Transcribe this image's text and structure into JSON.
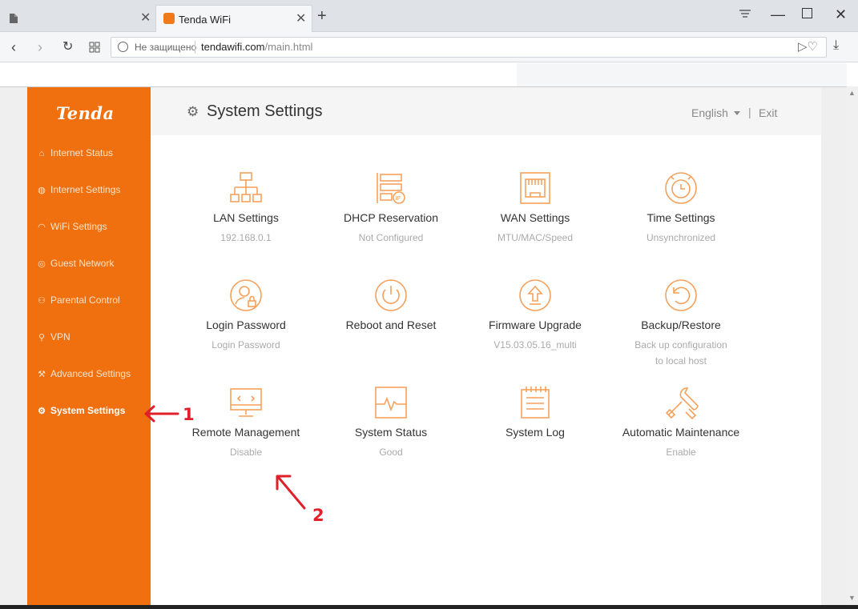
{
  "browser": {
    "tab_title": "Tenda WiFi",
    "security_label": "Не защищено",
    "url_host": "tendawifi.com",
    "url_path": "/main.html"
  },
  "app": {
    "logo": "Tenda",
    "page_title": "System Settings",
    "language": "English",
    "separator": "|",
    "exit": "Exit",
    "accent_color": "#f07010",
    "icon_color": "#f5a15c"
  },
  "sidebar": {
    "items": [
      {
        "label": "Internet Status",
        "icon": "router-icon"
      },
      {
        "label": "Internet Settings",
        "icon": "globe-icon"
      },
      {
        "label": "WiFi Settings",
        "icon": "wifi-icon"
      },
      {
        "label": "Guest Network",
        "icon": "guest-icon"
      },
      {
        "label": "Parental Control",
        "icon": "parental-icon"
      },
      {
        "label": "VPN",
        "icon": "vpn-icon"
      },
      {
        "label": "Advanced Settings",
        "icon": "wrench-icon"
      },
      {
        "label": "System Settings",
        "icon": "gear-icon",
        "active": true
      }
    ]
  },
  "tiles": [
    {
      "label": "LAN Settings",
      "sub": "192.168.0.1",
      "icon": "lan-icon"
    },
    {
      "label": "DHCP Reservation",
      "sub": "Not Configured",
      "icon": "dhcp-icon"
    },
    {
      "label": "WAN Settings",
      "sub": "MTU/MAC/Speed",
      "icon": "wan-icon"
    },
    {
      "label": "Time Settings",
      "sub": "Unsynchronized",
      "icon": "clock-icon"
    },
    {
      "label": "Login Password",
      "sub": "Login Password",
      "icon": "user-lock-icon"
    },
    {
      "label": "Reboot and Reset",
      "sub": "",
      "icon": "power-icon"
    },
    {
      "label": "Firmware Upgrade",
      "sub": "V15.03.05.16_multi",
      "icon": "upgrade-icon"
    },
    {
      "label": "Backup/Restore",
      "sub": "Back up configuration to local host",
      "icon": "backup-icon"
    },
    {
      "label": "Remote Management",
      "sub": "Disable",
      "icon": "monitor-icon"
    },
    {
      "label": "System Status",
      "sub": "Good",
      "icon": "status-icon"
    },
    {
      "label": "System Log",
      "sub": "",
      "icon": "log-icon"
    },
    {
      "label": "Automatic Maintenance",
      "sub": "Enable",
      "icon": "tools-icon"
    }
  ],
  "annotations": {
    "step1": "1",
    "step2": "2",
    "color": "#e0202a"
  }
}
